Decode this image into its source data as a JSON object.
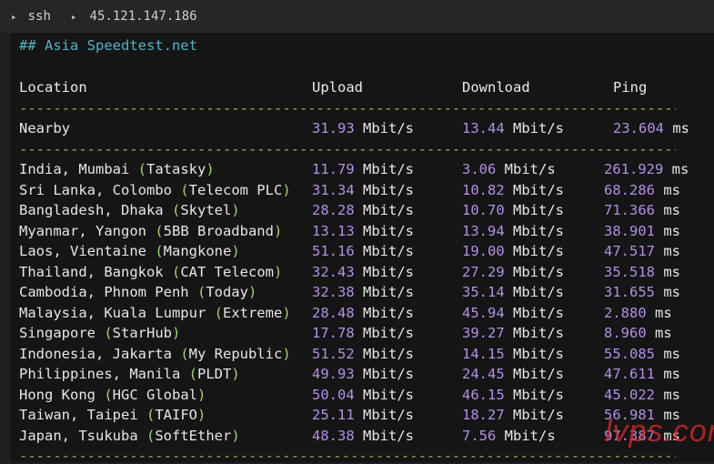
{
  "titlebar": {
    "app": "ssh",
    "host": "45.121.147.186"
  },
  "heading": "## Asia Speedtest.net",
  "columns": {
    "location": "Location",
    "upload": "Upload",
    "download": "Download",
    "ping": "Ping"
  },
  "separator": "------------------------------------------------------------------------------------------------",
  "nearby": {
    "location": "Nearby",
    "provider": "",
    "upload": "31.93",
    "download": "13.44",
    "ping": "23.604"
  },
  "units": {
    "speed": "Mbit/s",
    "ping": "ms"
  },
  "rows": [
    {
      "location": "India, Mumbai ",
      "provider": "Tatasky",
      "upload": "11.79",
      "download": "3.06",
      "ping": "261.929"
    },
    {
      "location": "Sri Lanka, Colombo ",
      "provider": "Telecom PLC",
      "upload": "31.34",
      "download": "10.82",
      "ping": "68.286"
    },
    {
      "location": "Bangladesh, Dhaka ",
      "provider": "Skytel",
      "upload": "28.28",
      "download": "10.70",
      "ping": "71.366"
    },
    {
      "location": "Myanmar, Yangon ",
      "provider": "5BB Broadband",
      "upload": "13.13",
      "download": "13.94",
      "ping": "38.901"
    },
    {
      "location": "Laos, Vientaine ",
      "provider": "Mangkone",
      "upload": "51.16",
      "download": "19.00",
      "ping": "47.517"
    },
    {
      "location": "Thailand, Bangkok ",
      "provider": "CAT Telecom",
      "upload": "32.43",
      "download": "27.29",
      "ping": "35.518"
    },
    {
      "location": "Cambodia, Phnom Penh ",
      "provider": "Today",
      "upload": "32.38",
      "download": "35.14",
      "ping": "31.655"
    },
    {
      "location": "Malaysia, Kuala Lumpur ",
      "provider": "Extreme",
      "upload": "28.48",
      "download": "45.94",
      "ping": "2.880"
    },
    {
      "location": "Singapore ",
      "provider": "StarHub",
      "upload": "17.78",
      "download": "39.27",
      "ping": "8.960"
    },
    {
      "location": "Indonesia, Jakarta ",
      "provider": "My Republic",
      "upload": "51.52",
      "download": "14.15",
      "ping": "55.085"
    },
    {
      "location": "Philippines, Manila ",
      "provider": "PLDT",
      "upload": "49.93",
      "download": "24.45",
      "ping": "47.611"
    },
    {
      "location": "Hong Kong ",
      "provider": "HGC Global",
      "upload": "50.04",
      "download": "46.15",
      "ping": "45.022"
    },
    {
      "location": "Taiwan, Taipei ",
      "provider": "TAIFO",
      "upload": "25.11",
      "download": "18.27",
      "ping": "56.981"
    },
    {
      "location": "Japan, Tsukuba ",
      "provider": "SoftEther",
      "upload": "48.38",
      "download": "7.56",
      "ping": "97.387"
    }
  ],
  "watermark": "lvps.com",
  "colors": {
    "number": "#b58ee6",
    "provider": "#9fd66a",
    "separator": "#8fbf4a",
    "heading": "#4fb3c8"
  }
}
